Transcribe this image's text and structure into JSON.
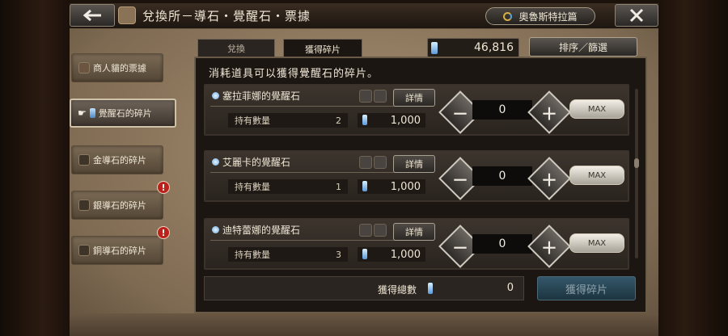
{
  "header": {
    "title": "兌換所－導石・覺醒石・票據",
    "region_button": "奧魯斯特拉篇"
  },
  "sidebar": {
    "items": [
      {
        "label": "商人貓的票據",
        "active": false,
        "alert": false
      },
      {
        "label": "覺醒石的碎片",
        "active": true,
        "alert": false
      },
      {
        "label": "金導石的碎片",
        "active": false,
        "alert": false
      },
      {
        "label": "銀導石的碎片",
        "active": false,
        "alert": true
      },
      {
        "label": "銅導石的碎片",
        "active": false,
        "alert": true
      }
    ],
    "alert_symbol": "!"
  },
  "tabs": [
    {
      "label": "兌換",
      "active": false
    },
    {
      "label": "獲得碎片",
      "active": true
    }
  ],
  "currency": {
    "value": "46,816",
    "icon": "crystal-shard-icon"
  },
  "sort_button": "排序／篩選",
  "list_header": "消耗道具可以獲得覺醒石的碎片。",
  "items": [
    {
      "name": "塞拉菲娜的覺醒石",
      "detail": "詳情",
      "owned_label": "持有數量",
      "owned": "2",
      "cost": "1,000",
      "qty": "0",
      "max": "MAX",
      "minus": "－",
      "plus": "＋"
    },
    {
      "name": "艾麗卡的覺醒石",
      "detail": "詳情",
      "owned_label": "持有數量",
      "owned": "1",
      "cost": "1,000",
      "qty": "0",
      "max": "MAX",
      "minus": "－",
      "plus": "＋"
    },
    {
      "name": "迪特蕾娜的覺醒石",
      "detail": "詳情",
      "owned_label": "持有數量",
      "owned": "3",
      "cost": "1,000",
      "qty": "0",
      "max": "MAX",
      "minus": "－",
      "plus": "＋"
    }
  ],
  "footer": {
    "total_label": "獲得總數",
    "total_value": "0",
    "obtain_button": "獲得碎片"
  },
  "icons": {
    "back": "arrow-left-icon",
    "close": "close-icon"
  }
}
